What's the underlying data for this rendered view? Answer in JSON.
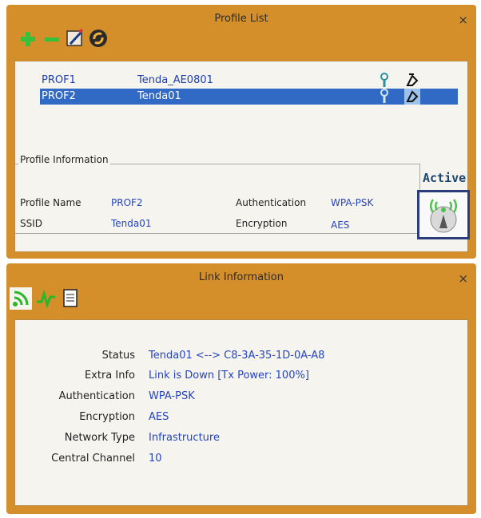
{
  "profile_panel": {
    "title": "Profile List",
    "close": "×",
    "toolbar": [
      "add-icon",
      "remove-icon",
      "edit-icon",
      "activate-icon"
    ],
    "profiles": [
      {
        "name": "PROF1",
        "ssid": "Tenda_AE0801",
        "selected": false
      },
      {
        "name": "PROF2",
        "ssid": "Tenda01",
        "selected": true
      }
    ],
    "info": {
      "legend": "Profile Information",
      "profile_name_label": "Profile Name",
      "profile_name": "PROF2",
      "ssid_label": "SSID",
      "ssid": "Tenda01",
      "auth_label": "Authentication",
      "auth": "WPA-PSK",
      "enc_label": "Encryption",
      "enc": "AES"
    },
    "active_label": "Active"
  },
  "link_panel": {
    "title": "Link Information",
    "close": "×",
    "tabs": [
      "signal-icon",
      "chart-icon",
      "document-icon"
    ],
    "rows": [
      {
        "label": "Status",
        "value": "Tenda01 <--> C8-3A-35-1D-0A-A8"
      },
      {
        "label": "Extra Info",
        "value": "Link is Down  [Tx Power: 100%]"
      },
      {
        "label": "Authentication",
        "value": "WPA-PSK"
      },
      {
        "label": "Encryption",
        "value": "AES"
      },
      {
        "label": "Network Type",
        "value": "Infrastructure"
      },
      {
        "label": "Central Channel",
        "value": "10"
      }
    ]
  },
  "colors": {
    "panel": "#d48f2b",
    "selection": "#316ac5",
    "value_text": "#2545c0",
    "green_icon": "#2bb52b"
  }
}
